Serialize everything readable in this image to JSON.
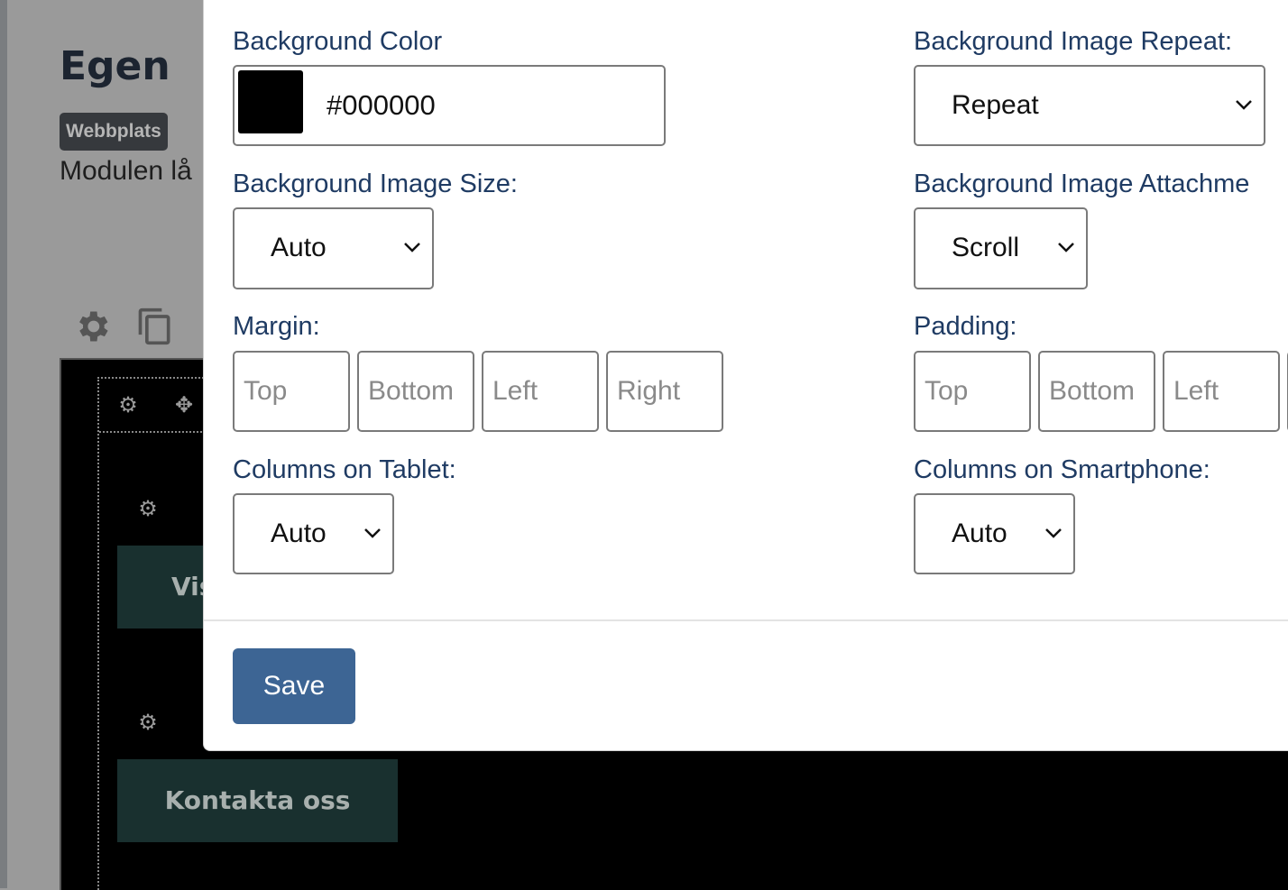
{
  "background": {
    "page_title": "Egen",
    "badge": "Webbplats",
    "description": "Modulen lå",
    "buttons": [
      "Vis",
      "Kontakta oss"
    ]
  },
  "modal": {
    "bg_color": {
      "label": "Background Color",
      "value": "#000000",
      "swatch": "#000000"
    },
    "bg_repeat": {
      "label": "Background Image Repeat:",
      "value": "Repeat"
    },
    "bg_size": {
      "label": "Background Image Size:",
      "value": "Auto"
    },
    "bg_attachment": {
      "label": "Background Image Attachme",
      "value": "Scroll"
    },
    "margin": {
      "label": "Margin:",
      "top": "Top",
      "bottom": "Bottom",
      "left": "Left",
      "right": "Right"
    },
    "padding": {
      "label": "Padding:",
      "top": "Top",
      "bottom": "Bottom",
      "left": "Left"
    },
    "columns_tablet": {
      "label": "Columns on Tablet:",
      "value": "Auto"
    },
    "columns_smartphone": {
      "label": "Columns on Smartphone:",
      "value": "Auto"
    },
    "save_label": "Save"
  },
  "colors": {
    "label": "#1f3b63",
    "save": "#3d6594",
    "bg_button": "#19302f"
  }
}
